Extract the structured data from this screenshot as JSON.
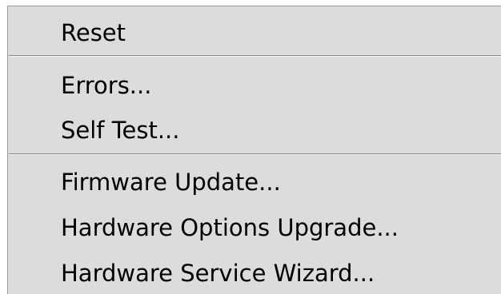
{
  "menu": {
    "items": [
      {
        "label": "Reset"
      },
      {
        "label": "Errors..."
      },
      {
        "label": "Self Test..."
      },
      {
        "label": "Firmware Update..."
      },
      {
        "label": "Hardware Options Upgrade..."
      },
      {
        "label": "Hardware Service Wizard..."
      }
    ]
  },
  "colors": {
    "menu_background": "#dcdcdc",
    "separator": "#8a8a8a",
    "text": "#000000"
  }
}
